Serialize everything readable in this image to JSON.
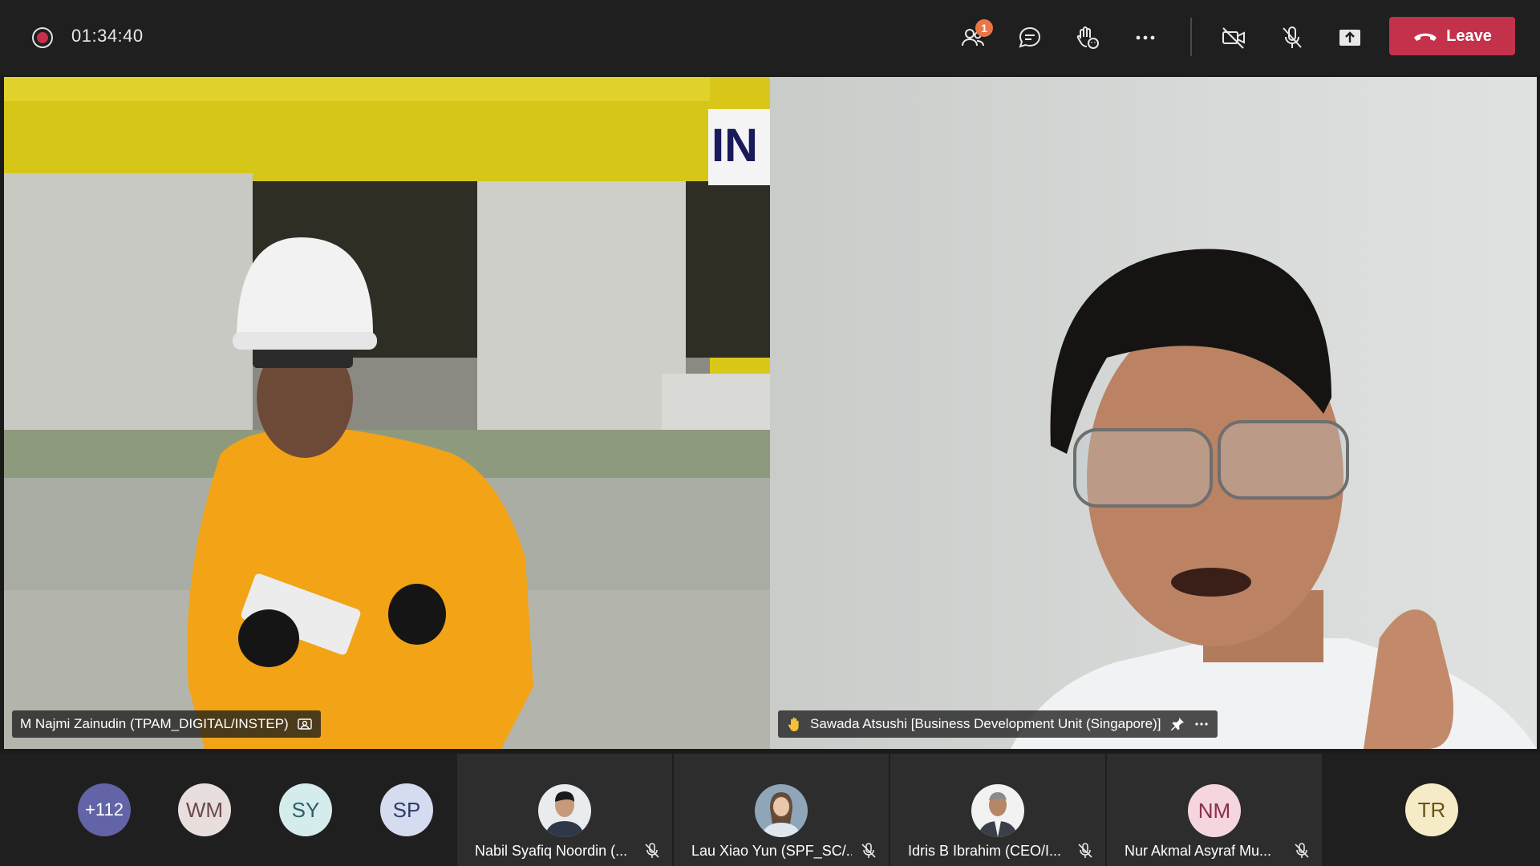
{
  "timer": "01:34:40",
  "toolbar": {
    "participants_badge": "1",
    "leave_label": "Leave"
  },
  "videos": [
    {
      "name": "M Najmi Zainudin (TPAM_DIGITAL/INSTEP)"
    },
    {
      "name": "Sawada Atsushi [Business Development Unit (Singapore)]"
    }
  ],
  "overflow_count": "+112",
  "avatars": [
    {
      "initials": "WM",
      "bg": "#e8dede",
      "fg": "#6b4a4a"
    },
    {
      "initials": "SY",
      "bg": "#d4ecec",
      "fg": "#2c5f66"
    },
    {
      "initials": "SP",
      "bg": "#d5dcef",
      "fg": "#2f3c6b"
    },
    {
      "initials": "NM",
      "bg": "#f5d6de",
      "fg": "#8a2f47"
    },
    {
      "initials": "TR",
      "bg": "#f5ebc6",
      "fg": "#6b5313"
    }
  ],
  "participants": [
    {
      "name": "Nabil Syafiq Noordin (..."
    },
    {
      "name": "Lau Xiao Yun (SPF_SC/..."
    },
    {
      "name": "Idris B Ibrahim (CEO/I..."
    },
    {
      "name": "Nur Akmal Asyraf Mu..."
    }
  ],
  "colors": {
    "leave": "#c4314b",
    "recording": "#c4314b",
    "overflow_bg": "#6264a7"
  }
}
